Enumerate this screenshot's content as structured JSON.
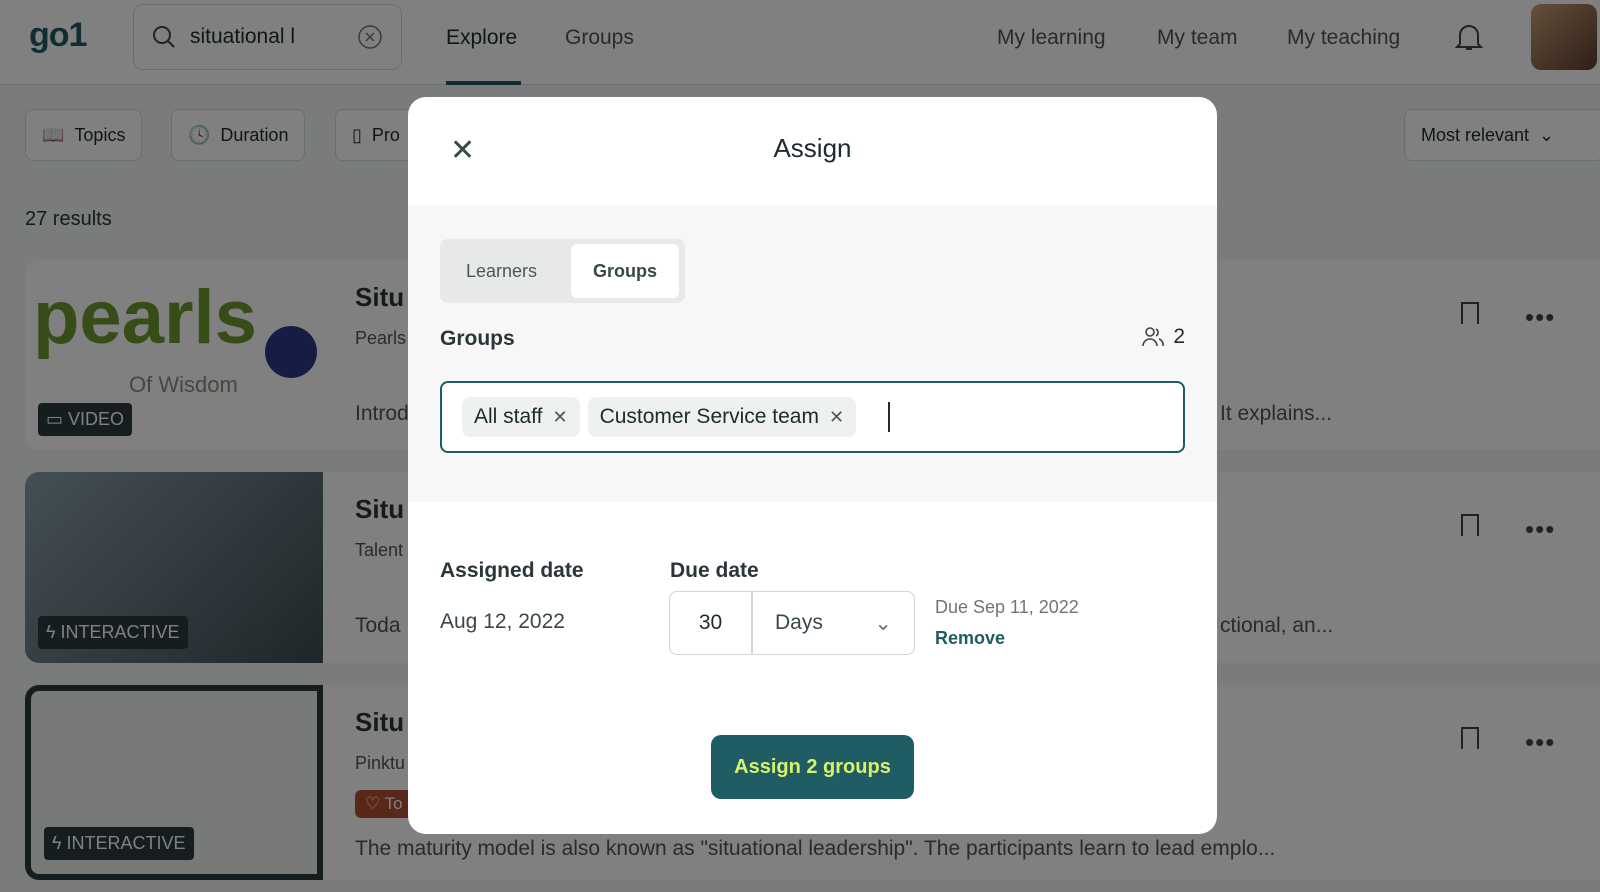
{
  "header": {
    "logo": "go1",
    "search_value": "situational l",
    "nav": [
      {
        "label": "Explore",
        "active": true
      },
      {
        "label": "Groups"
      }
    ],
    "right_nav": [
      "My learning",
      "My team",
      "My teaching"
    ]
  },
  "filters": [
    "Topics",
    "Duration",
    "Pro"
  ],
  "sort": "Most relevant",
  "results_count": "27 results",
  "cards": [
    {
      "title": "Situ",
      "provider": "Pearls",
      "desc_left": "Introd",
      "desc_right": "It explains...",
      "badge": "VIDEO",
      "image_text": "pearls",
      "image_sub": "Of Wisdom"
    },
    {
      "title": "Situ",
      "provider": "Talent",
      "desc_left": "Toda",
      "desc_right": "ctional, an...",
      "badge": "INTERACTIVE"
    },
    {
      "title": "Situ",
      "provider": "Pinktu",
      "tag": "To",
      "desc": "The maturity model is also known as \"situational leadership\". The participants learn to lead emplo...",
      "badge": "INTERACTIVE"
    }
  ],
  "modal": {
    "title": "Assign",
    "tabs": [
      {
        "label": "Learners"
      },
      {
        "label": "Groups",
        "selected": true
      }
    ],
    "groups_label": "Groups",
    "groups_count": "2",
    "selected_groups": [
      "All staff",
      "Customer Service team"
    ],
    "assigned_date_label": "Assigned date",
    "assigned_date": "Aug 12, 2022",
    "due_date_label": "Due date",
    "due_amount": "30",
    "due_unit": "Days",
    "due_text": "Due Sep 11, 2022",
    "remove_label": "Remove",
    "assign_button": "Assign 2 groups"
  },
  "colors": {
    "brand": "#1f5c63",
    "button_text": "#d8f36b"
  }
}
